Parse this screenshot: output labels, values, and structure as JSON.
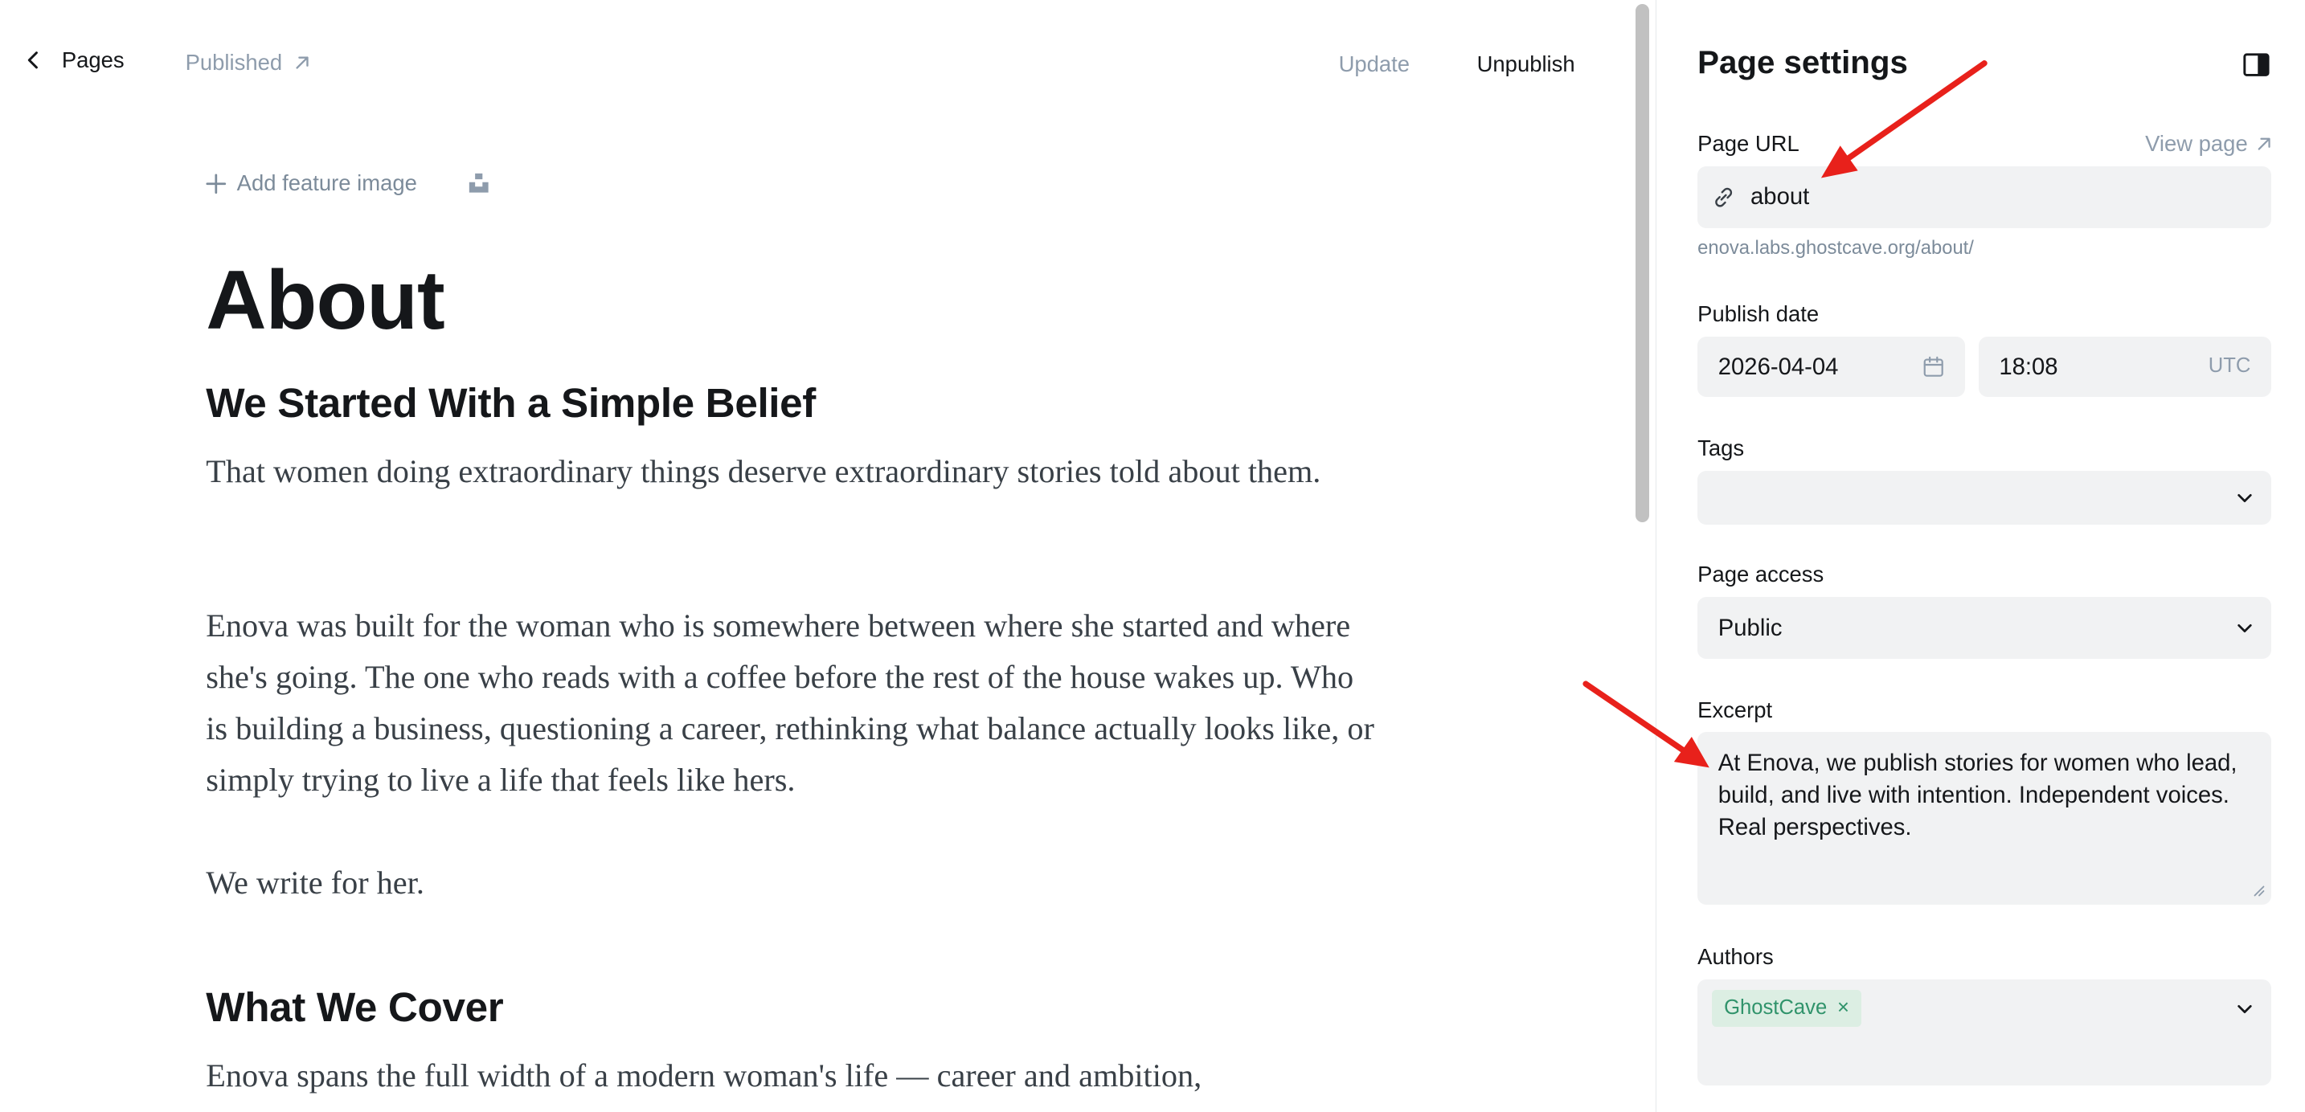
{
  "topbar": {
    "back_label": "Pages",
    "status_label": "Published",
    "update_label": "Update",
    "unpublish_label": "Unpublish"
  },
  "editor": {
    "feature_image_label": "Add feature image",
    "title": "About",
    "heading_1": "We Started With a Simple Belief",
    "para_1": "That women doing extraordinary things deserve extraordinary stories told about them.",
    "para_2": "Enova was built for the woman who is somewhere between where she started and where she's going. The one who reads with a coffee before the rest of the house wakes up. Who is building a business, questioning a career, rethinking what balance actually looks like, or simply trying to live a life that feels like hers.",
    "para_3": "We write for her.",
    "heading_2": "What We Cover",
    "para_4": "Enova spans the full width of a modern woman's life — career and ambition,"
  },
  "settings": {
    "title": "Page settings",
    "url_label": "Page URL",
    "view_page_label": "View page",
    "url_value": "about",
    "url_hint": "enova.labs.ghostcave.org/about/",
    "publish_date_label": "Publish date",
    "date_value": "2026-04-04",
    "time_value": "18:08",
    "timezone": "UTC",
    "tags_label": "Tags",
    "access_label": "Page access",
    "access_value": "Public",
    "excerpt_label": "Excerpt",
    "excerpt_value": "At Enova, we publish stories for women who lead, build, and live with intention. Independent voices. Real perspectives.",
    "authors_label": "Authors",
    "author_chip": "GhostCave",
    "author_remove_glyph": "×"
  },
  "colors": {
    "annotation_arrow": "#e8211b",
    "field_bg": "#f1f2f3",
    "chip_bg": "#dceee3",
    "chip_text": "#30936b"
  },
  "icons": [
    "chevron-left-icon",
    "arrow-up-right-icon",
    "plus-icon",
    "unsplash-icon",
    "link-icon",
    "calendar-icon",
    "chevron-down-icon",
    "sidebar-toggle-icon"
  ]
}
